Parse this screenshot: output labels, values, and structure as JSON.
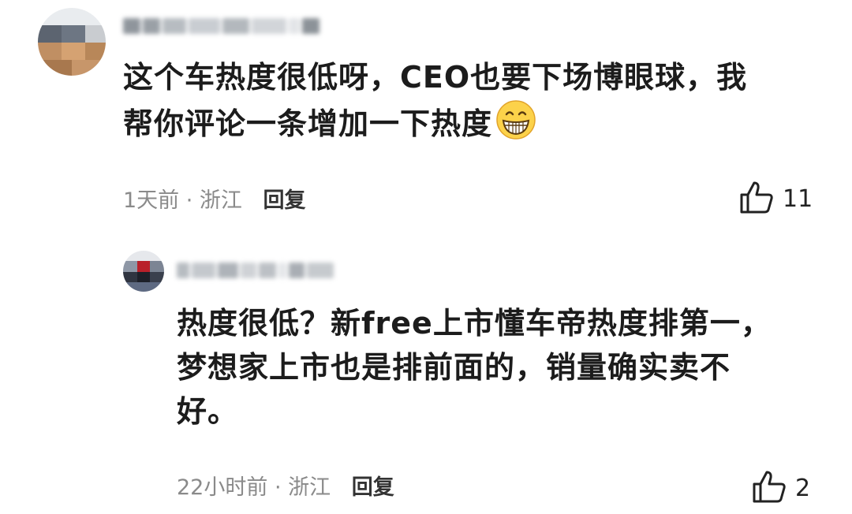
{
  "comment": {
    "text_line1": "这个车热度很低呀，CEO也要下场博眼球，我",
    "text_line2": "帮你评论一条增加一下热度",
    "emoji": "grinning-face-emoji",
    "meta_time_location": "1天前 · 浙江",
    "reply_label": "回复",
    "likes": "11"
  },
  "reply": {
    "text_line1": "热度很低？新free上市懂车帝热度排第一，",
    "text_line2": "梦想家上市也是排前面的，销量确实卖不",
    "text_line3": "好。",
    "meta_time_location": "22小时前 · 浙江",
    "reply_label": "回复",
    "likes": "2"
  },
  "icons": {
    "like": "thumbs-up-icon"
  }
}
